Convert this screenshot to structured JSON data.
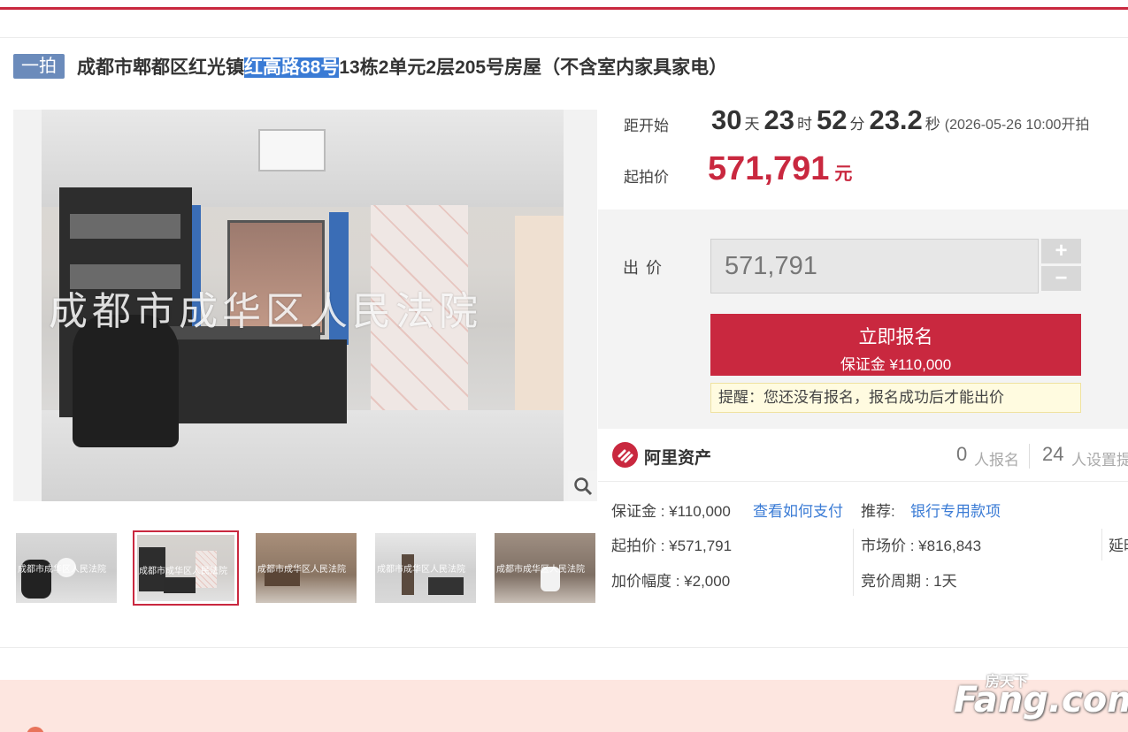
{
  "title": {
    "badge": "一拍",
    "prefix": "成都市郫都区红光镇",
    "highlight": "红高路88号",
    "suffix": "13栋2单元2层205号房屋（不含室内家具家电）"
  },
  "image": {
    "watermark": "成都市成华区人民法院",
    "thumb_watermark": "成都市成华区人民法院",
    "selected_thumb": 2
  },
  "countdown": {
    "label": "距开始",
    "days": "30",
    "days_unit": "天",
    "hours": "23",
    "hours_unit": "时",
    "minutes": "52",
    "minutes_unit": "分",
    "seconds": "23.2",
    "seconds_unit": "秒",
    "start_note": "(2026-05-26 10:00开拍"
  },
  "start_price": {
    "label": "起拍价",
    "value": "571,791",
    "unit": "元"
  },
  "bid": {
    "label": "出价",
    "input_value": "571,791",
    "plus": "+",
    "minus": "−",
    "apply_label": "立即报名",
    "deposit_label": "保证金 ¥110,000",
    "notice": "提醒：您还没有报名，报名成功后才能出价"
  },
  "seller": {
    "name": "阿里资产",
    "signups": "0",
    "signups_label": "人报名",
    "reminders": "24",
    "reminders_label": "人设置提"
  },
  "details": {
    "deposit": "保证金 : ¥110,000",
    "how_to_pay": "查看如何支付",
    "recommend_label": "推荐:",
    "recommend_link": "银行专用款项",
    "start_price": "起拍价 : ¥571,791",
    "market_price": "市场价 : ¥816,843",
    "delay": "延时",
    "increment": "加价幅度 : ¥2,000",
    "cycle": "竞价周期 : 1天"
  },
  "footer": {
    "logo_sub": "房天下",
    "logo_main": "Fang.com"
  },
  "colors": {
    "accent": "#c9283f",
    "link": "#3a7bd5",
    "badge": "#6b8bbb"
  }
}
